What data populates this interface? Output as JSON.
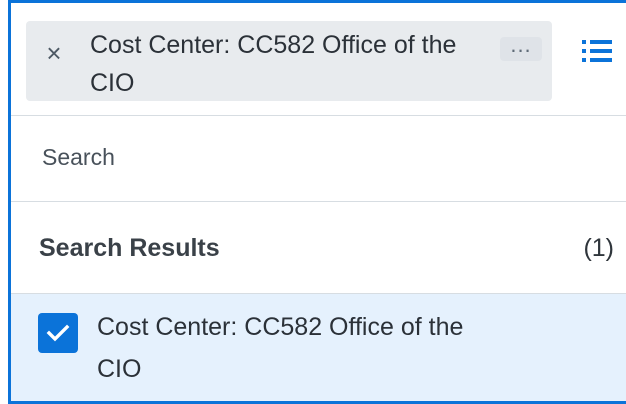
{
  "chip": {
    "label": "Cost Center: CC582 Office of the CIO",
    "more_label": "..."
  },
  "search": {
    "placeholder": "Search"
  },
  "results": {
    "title": "Search Results",
    "count": "(1)",
    "items": [
      {
        "label": "Cost Center: CC582 Office of the CIO",
        "checked": true
      }
    ]
  },
  "icons": {
    "remove": "close-icon",
    "more": "more-icon",
    "list": "list-icon",
    "check": "check-icon"
  },
  "colors": {
    "accent": "#0b73d9",
    "chip_bg": "#e8ebee",
    "selected_row": "#e5f1fd",
    "divider": "#d7dde2"
  }
}
